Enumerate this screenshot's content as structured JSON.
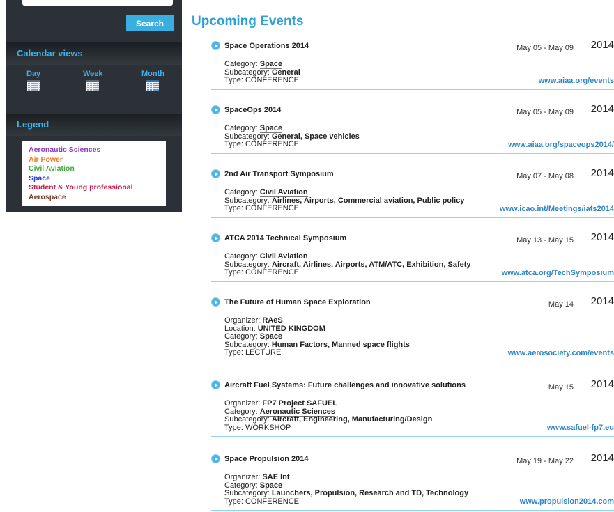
{
  "sidebar": {
    "search_button": "Search",
    "calendar_views_heading": "Calendar views",
    "views": [
      "Day",
      "Week",
      "Month"
    ],
    "legend_heading": "Legend",
    "legend": [
      {
        "label": "Aeronautic Sciences",
        "color": "#8e3fb6"
      },
      {
        "label": "Air Power",
        "color": "#ef7a1d"
      },
      {
        "label": "Civil Aviation",
        "color": "#47a83b"
      },
      {
        "label": "Space",
        "color": "#2a3bd0"
      },
      {
        "label": "Student & Young professional",
        "color": "#c41f4c"
      },
      {
        "label": "Aerospace",
        "color": "#7a3f2f"
      }
    ]
  },
  "main": {
    "title": "Upcoming Events",
    "events": [
      {
        "title": "Space Operations 2014",
        "dates": "May 05 - May 09",
        "year": "2014",
        "lines": [
          {
            "k": "Category: ",
            "v": "Space",
            "cat": true
          },
          {
            "k": "Subcategory: ",
            "v": "General"
          },
          {
            "k": "Type: ",
            "v": "CONFERENCE",
            "plain": true
          }
        ],
        "link": "www.aiaa.org/events"
      },
      {
        "title": "SpaceOps 2014",
        "dates": "May 05 - May 09",
        "year": "2014",
        "lines": [
          {
            "k": "Category: ",
            "v": "Space",
            "cat": true
          },
          {
            "k": "Subcategory: ",
            "v": "General, Space vehicles"
          },
          {
            "k": "Type: ",
            "v": "CONFERENCE",
            "plain": true
          }
        ],
        "link": "www.aiaa.org/spaceops2014/"
      },
      {
        "title": "2nd Air Transport Symposium",
        "dates": "May 07 - May 08",
        "year": "2014",
        "lines": [
          {
            "k": "Category: ",
            "v": "Civil Aviation",
            "cat": true
          },
          {
            "k": "Subcategory: ",
            "v": "Airlines, Airports, Commercial aviation, Public policy"
          },
          {
            "k": "Type: ",
            "v": "CONFERENCE",
            "plain": true
          }
        ],
        "link": "www.icao.int/Meetings/iats2014"
      },
      {
        "title": "ATCA 2014 Technical Symposium",
        "dates": "May 13 - May 15",
        "year": "2014",
        "lines": [
          {
            "k": "Category: ",
            "v": "Civil Aviation",
            "cat": true
          },
          {
            "k": "Subcategory: ",
            "v": "Aircraft, Airlines, Airports, ATM/ATC, Exhibition, Safety"
          },
          {
            "k": "Type: ",
            "v": "CONFERENCE",
            "plain": true
          }
        ],
        "link": "www.atca.org/TechSymposium"
      },
      {
        "title": "The Future of Human Space Exploration",
        "dates": "May 14",
        "year": "2014",
        "lines": [
          {
            "k": "Organizer: ",
            "v": "RAeS"
          },
          {
            "k": "Location: ",
            "v": "UNITED KINGDOM"
          },
          {
            "k": "Category: ",
            "v": "Space",
            "cat": true
          },
          {
            "k": "Subcategory: ",
            "v": "Human Factors, Manned space flights"
          },
          {
            "k": "Type: ",
            "v": "LECTURE",
            "plain": true
          }
        ],
        "link": "www.aerosociety.com/events"
      },
      {
        "title": "Aircraft Fuel Systems: Future challenges and innovative solutions",
        "dates": "May 15",
        "year": "2014",
        "lines": [
          {
            "k": "Organizer: ",
            "v": "FP7 Project SAFUEL"
          },
          {
            "k": "Category: ",
            "v": "Aeronautic Sciences",
            "cat": true
          },
          {
            "k": "Subcategory: ",
            "v": "Aircraft, Engineering, Manufacturing/Design"
          },
          {
            "k": "Type: ",
            "v": "WORKSHOP",
            "plain": true
          }
        ],
        "link": "www.safuel-fp7.eu"
      },
      {
        "title": "Space Propulsion 2014",
        "dates": "May 19 - May 22",
        "year": "2014",
        "lines": [
          {
            "k": "Organizer: ",
            "v": "SAE Int"
          },
          {
            "k": "Category: ",
            "v": "Space",
            "cat": true
          },
          {
            "k": "Subcategory: ",
            "v": "Launchers, Propulsion, Research and TD, Technology"
          },
          {
            "k": "Type: ",
            "v": "CONFERENCE",
            "plain": true
          }
        ],
        "link": "www.propulsion2014.com"
      }
    ]
  }
}
